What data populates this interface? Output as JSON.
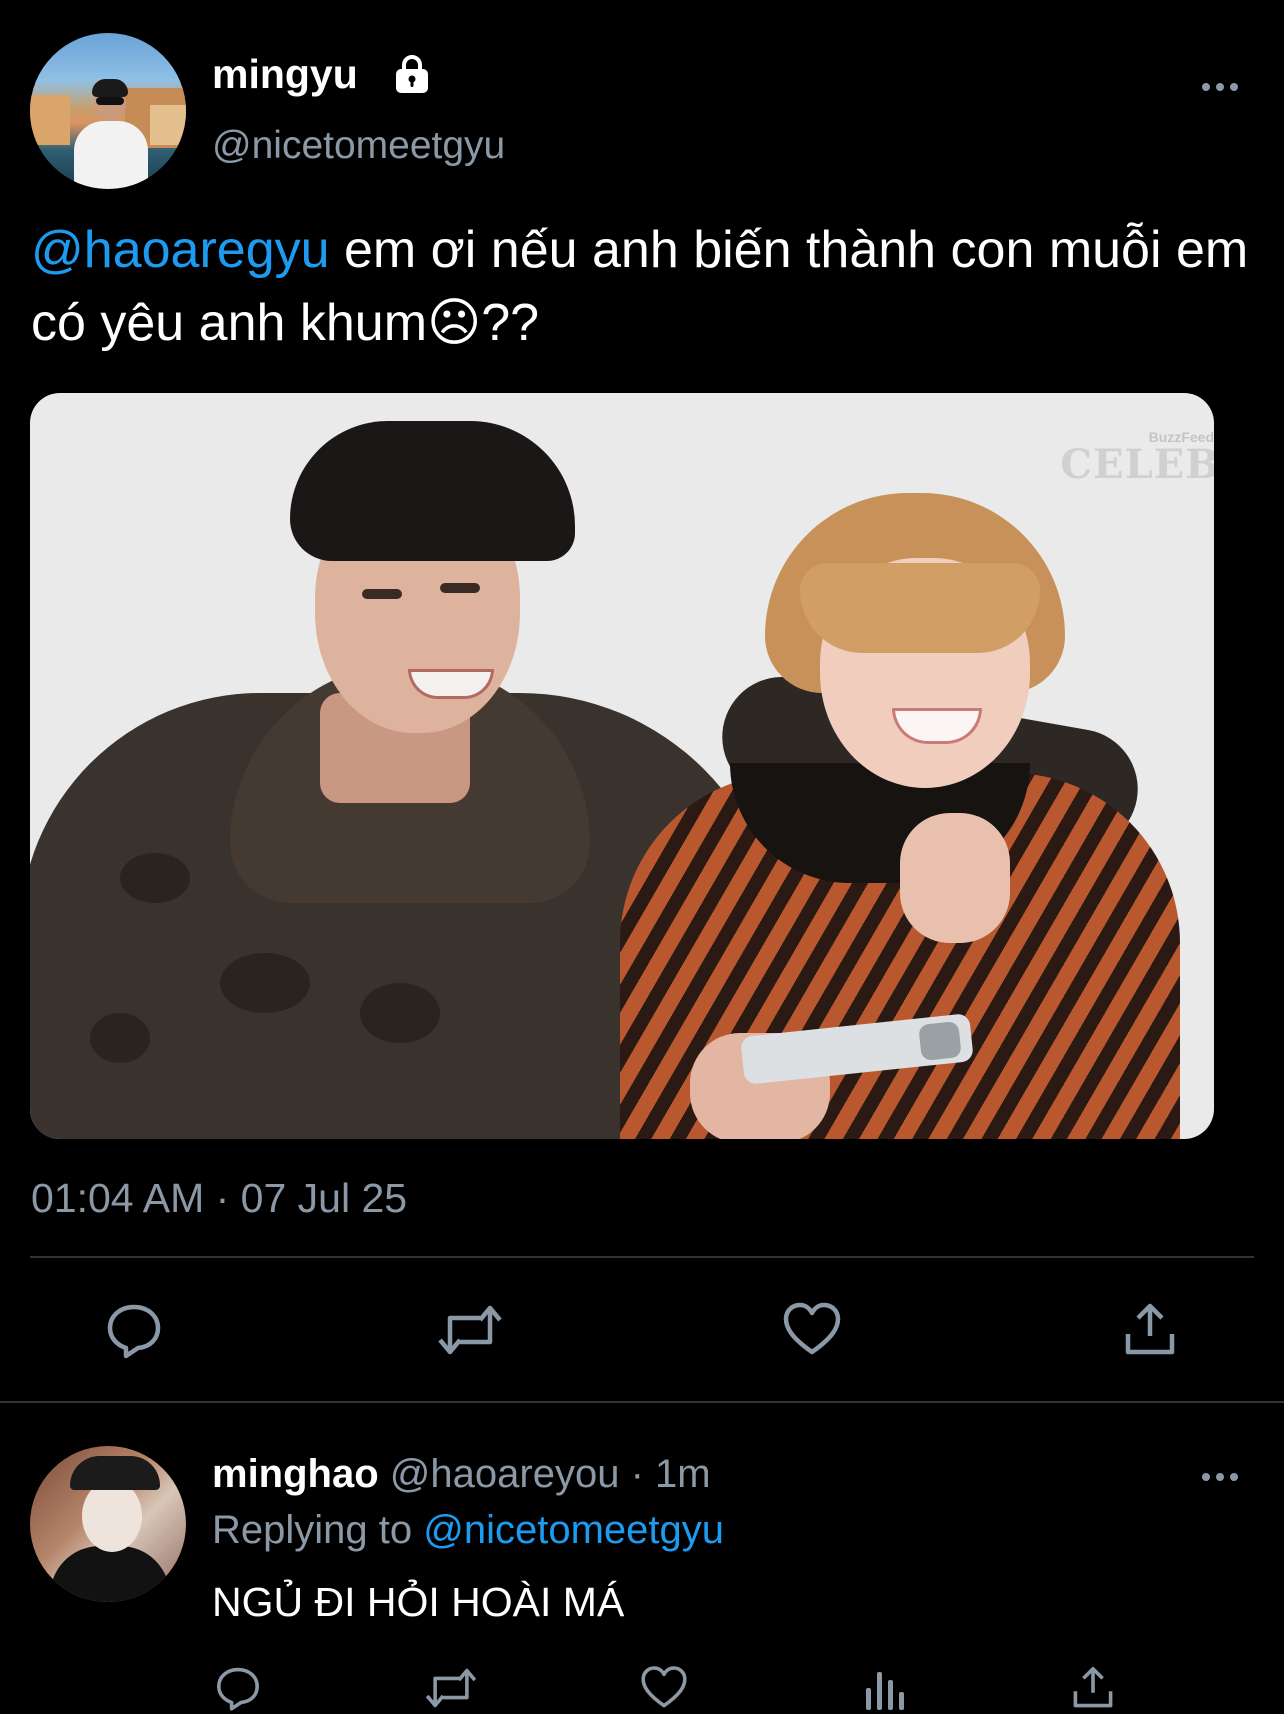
{
  "tweet": {
    "display_name": "mingyu",
    "handle": "@nicetomeetgyu",
    "mention": "@haoaregyu",
    "text": " em ơi nếu anh biến thành con muỗi em có yêu anh khum☹??",
    "photo_watermark_small": "BuzzFeed",
    "photo_watermark_large": "CELEB",
    "timestamp": "01:04 AM · 07 Jul 25"
  },
  "reply": {
    "display_name": "minghao",
    "handle": "@haoareyou",
    "time": " · 1m",
    "replying_label": "Replying to ",
    "replying_to": "@nicetomeetgyu",
    "text": "NGỦ ĐI HỎI HOÀI MÁ"
  },
  "icons": {
    "lock": "lock-icon",
    "more": "more-horizontal-icon",
    "reply": "reply-icon",
    "retweet": "retweet-icon",
    "like": "heart-icon",
    "share": "share-icon",
    "stats": "analytics-icon"
  },
  "colors": {
    "background": "#000000",
    "text": "#ffffff",
    "secondary": "#8b98a5",
    "link": "#1d9bf0",
    "divider": "#2f3336"
  }
}
